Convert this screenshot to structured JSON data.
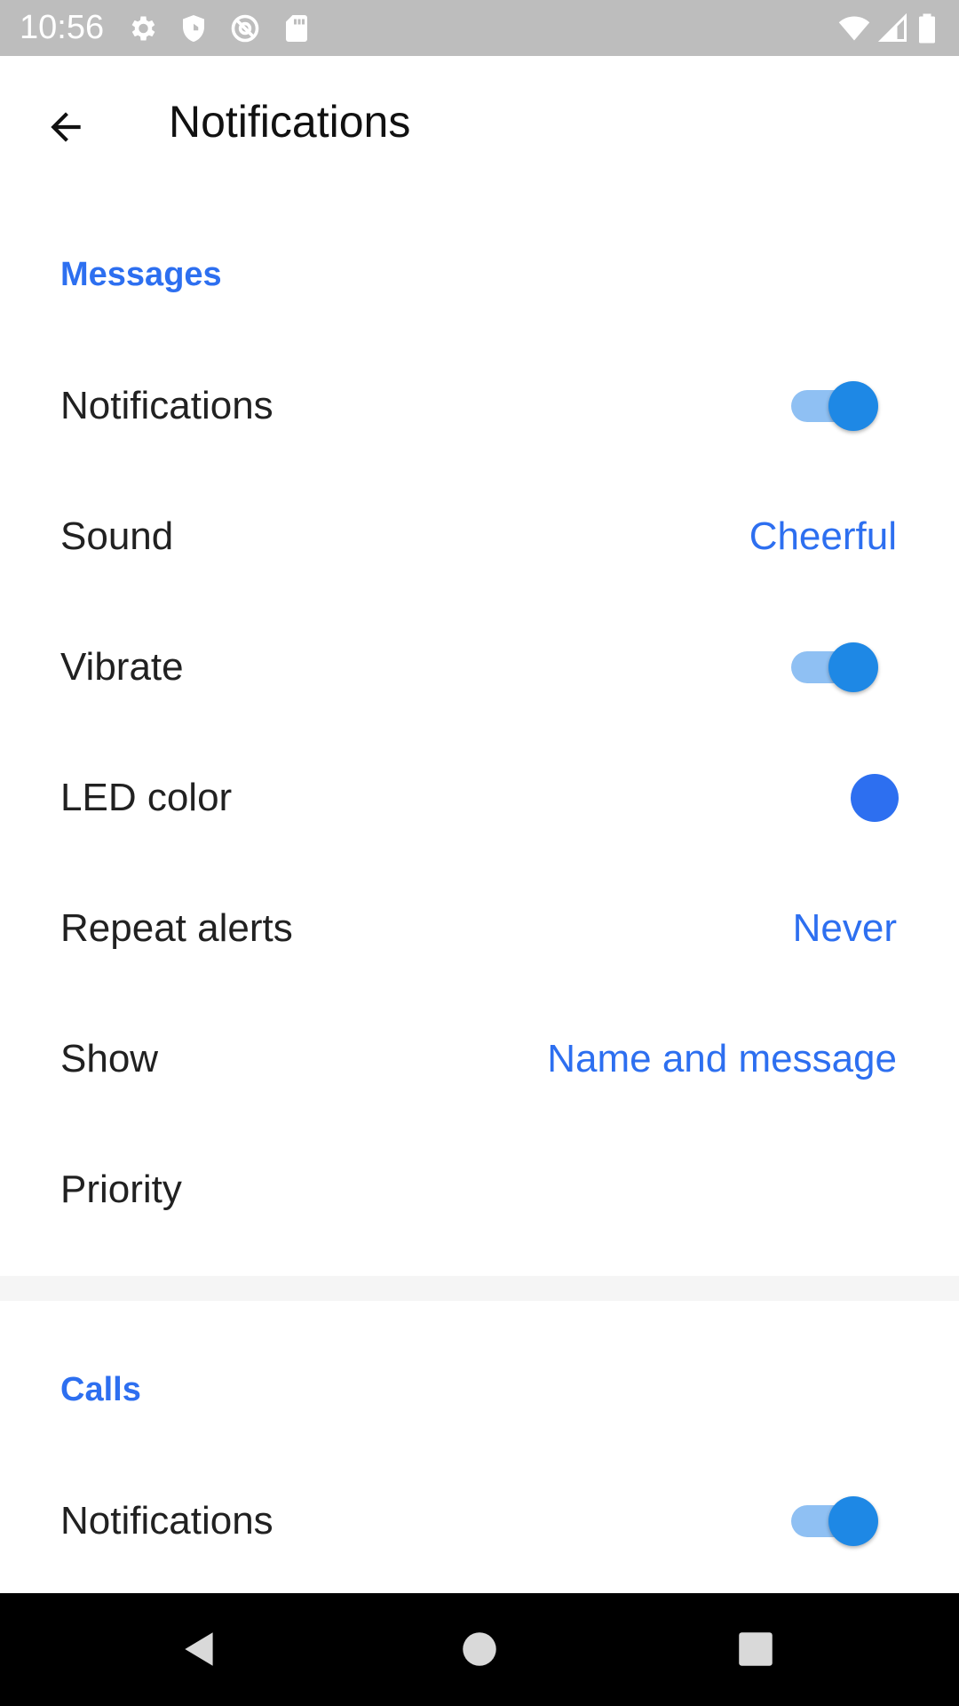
{
  "status_bar": {
    "time": "10:56",
    "left_icons": [
      "settings-icon",
      "shield-icon",
      "at-sign-icon",
      "sd-card-icon"
    ],
    "right_icons": [
      "wifi-icon",
      "cell-signal-icon",
      "battery-icon"
    ]
  },
  "app_bar": {
    "title": "Notifications",
    "back_icon": "arrow-back-icon"
  },
  "colors": {
    "accent": "#2d6ff0",
    "toggle_thumb": "#1e88e5",
    "toggle_track": "#8fc0f3",
    "led_color": "#2d6ff0"
  },
  "messages": {
    "header": "Messages",
    "notifications": {
      "label": "Notifications",
      "enabled": true
    },
    "sound": {
      "label": "Sound",
      "value": "Cheerful"
    },
    "vibrate": {
      "label": "Vibrate",
      "enabled": true
    },
    "led_color": {
      "label": "LED color"
    },
    "repeat_alerts": {
      "label": "Repeat alerts",
      "value": "Never"
    },
    "show": {
      "label": "Show",
      "value": "Name and message"
    },
    "priority": {
      "label": "Priority"
    }
  },
  "calls": {
    "header": "Calls",
    "notifications": {
      "label": "Notifications",
      "enabled": true
    }
  },
  "nav_bar": {
    "buttons": [
      "back-triangle-icon",
      "home-circle-icon",
      "recents-square-icon"
    ]
  }
}
